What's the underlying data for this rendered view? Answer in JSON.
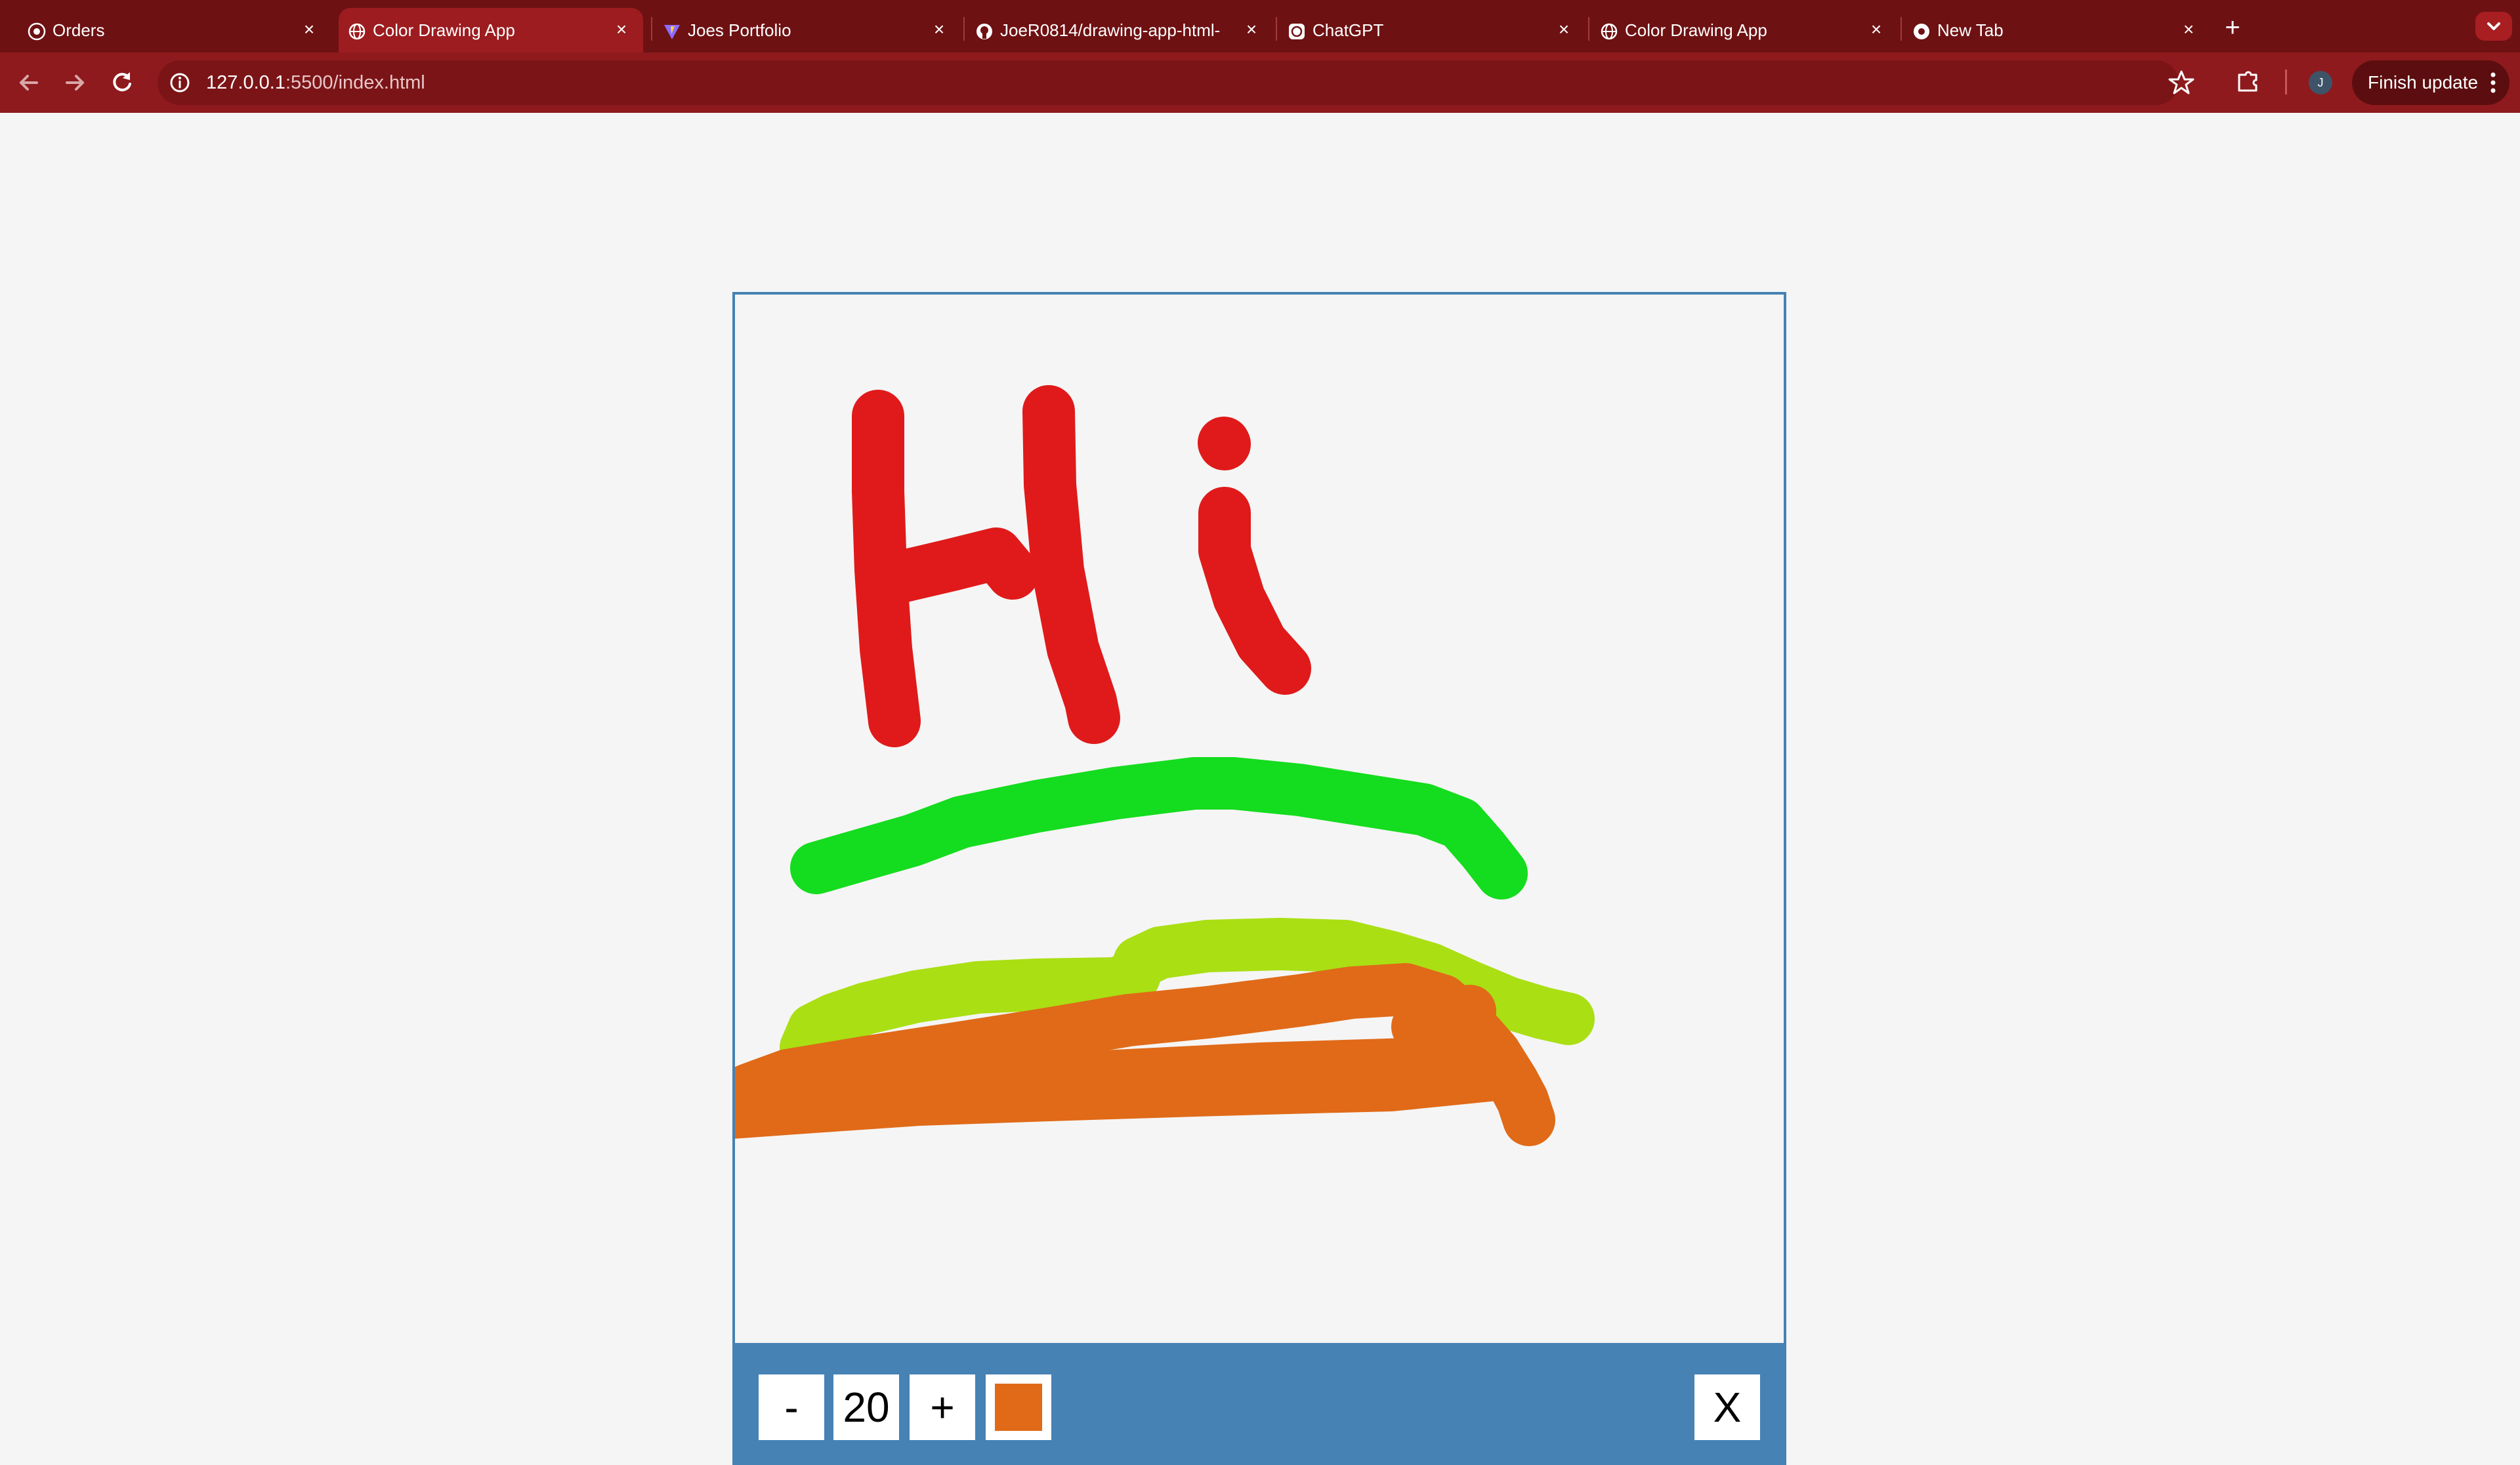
{
  "browser": {
    "tabs": [
      {
        "title": "Orders",
        "icon": "orders-icon",
        "active": false
      },
      {
        "title": "Color Drawing App",
        "icon": "globe-icon",
        "active": true
      },
      {
        "title": "Joes Portfolio",
        "icon": "vite-icon",
        "active": false
      },
      {
        "title": "JoeR0814/drawing-app-html-",
        "icon": "github-icon",
        "active": false
      },
      {
        "title": "ChatGPT",
        "icon": "chatgpt-icon",
        "active": false
      },
      {
        "title": "Color Drawing App",
        "icon": "globe-icon",
        "active": false
      },
      {
        "title": "New Tab",
        "icon": "chrome-icon",
        "active": false
      }
    ],
    "tab_close_label": "×",
    "new_tab_label": "+",
    "url_host": "127.0.0.1",
    "url_path": ":5500/index.html",
    "profile_initial": "J",
    "finish_update_label": "Finish update"
  },
  "app": {
    "decrease_label": "-",
    "brush_size": "20",
    "increase_label": "+",
    "clear_label": "X",
    "current_color": "#e06a18"
  },
  "colors": {
    "accent_panel": "#4682b4",
    "stroke_red": "#e01a1a",
    "stroke_green": "#14dc1e",
    "stroke_lime": "#aadf14",
    "stroke_orange": "#e06a18"
  }
}
